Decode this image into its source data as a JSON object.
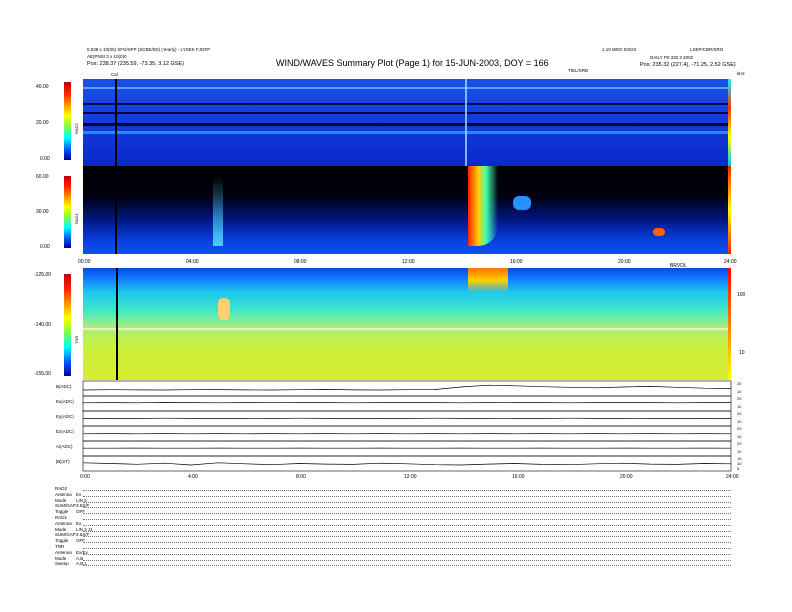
{
  "header": {
    "title": "WIND/WAVES Summary Plot (Page 1) for 15-JUN-2003, DOY = 166",
    "left_line1": "0.538 x 10(00) SFG/SFP (SCBE/D0) (Yearly) - LYSEK FJGFP",
    "left_line2": "AE(PNSI 3 x 10(0)0",
    "left_line3": "Pos:  238.37 (235.59, -73.35, 3.12 GSE)",
    "right_line1": "1.10 WED 03/O3",
    "right_line2": "LSEP/CBR/SRO",
    "right_line3": "DAILY P0 335 3 2002",
    "right_line4": "Pos:  235.32 (227.4), -71.25, 2.52 GSE)",
    "cal_label": "Cal",
    "panel1_tag": "TIEL/SRB",
    "right_khz": "kHz"
  },
  "chart_data": [
    {
      "type": "heatmap",
      "title": "",
      "ylabel": "RAD2",
      "yticks": [
        "40.00",
        "20.00",
        "0.00"
      ]
    },
    {
      "type": "heatmap",
      "title": "",
      "ylabel": "RAD1",
      "yticks": [
        "60.00",
        "30.00",
        "0.00"
      ],
      "xticks": [
        "00:00",
        "04:00",
        "08:00",
        "12:00",
        "16:00",
        "20:00",
        "24:00"
      ]
    },
    {
      "type": "heatmap",
      "title": "",
      "ylabel": "TNR",
      "yticks": [
        "-125.00",
        "-140.00",
        "-155.00"
      ],
      "right_ticks": [
        "100",
        "10"
      ],
      "right_tag": "BRVDL"
    },
    {
      "type": "line",
      "title": "",
      "x_range_hours": [
        0,
        24
      ],
      "xticks": [
        "0:00",
        "4:00",
        "8:00",
        "12:00",
        "16:00",
        "20:00",
        "24:00"
      ],
      "series": [
        {
          "name": "B(ADC)",
          "right_ticks": [
            "20",
            "10"
          ],
          "values": [
            0.4,
            0.42,
            0.41,
            0.4,
            0.42,
            0.43,
            0.41,
            0.4,
            0.42,
            0.44,
            0.41,
            0.4,
            0.42,
            0.43,
            0.6,
            0.72,
            0.68,
            0.62,
            0.58,
            0.55,
            0.6,
            0.64,
            0.58,
            0.52,
            0.5
          ]
        },
        {
          "name": "Ex(ADC)",
          "right_ticks": [
            "20",
            "10"
          ],
          "values": [
            0.55,
            0.56,
            0.55,
            0.57,
            0.56,
            0.55,
            0.56,
            0.58,
            0.57,
            0.56,
            0.55,
            0.56,
            0.57,
            0.56,
            0.55,
            0.56,
            0.57,
            0.56,
            0.55,
            0.56,
            0.57,
            0.56,
            0.55,
            0.56,
            0.56
          ]
        },
        {
          "name": "Ey(ADC)",
          "right_ticks": [
            "20",
            "10"
          ],
          "values": [
            0.5,
            0.51,
            0.5,
            0.52,
            0.51,
            0.5,
            0.51,
            0.5,
            0.52,
            0.51,
            0.5,
            0.51,
            0.5,
            0.52,
            0.51,
            0.5,
            0.51,
            0.5,
            0.52,
            0.51,
            0.5,
            0.51,
            0.5,
            0.51,
            0.5
          ]
        },
        {
          "name": "Ez(ADC)",
          "right_ticks": [
            "20",
            "10"
          ],
          "values": [
            0.48,
            0.49,
            0.48,
            0.49,
            0.48,
            0.49,
            0.48,
            0.49,
            0.48,
            0.49,
            0.48,
            0.49,
            0.48,
            0.49,
            0.48,
            0.49,
            0.48,
            0.49,
            0.48,
            0.49,
            0.48,
            0.49,
            0.48,
            0.49,
            0.48
          ]
        },
        {
          "name": "Ai(ADC)",
          "right_ticks": [
            "20",
            "10"
          ],
          "values": [
            0.52,
            0.52,
            0.53,
            0.52,
            0.52,
            0.53,
            0.52,
            0.52,
            0.53,
            0.52,
            0.52,
            0.53,
            0.52,
            0.52,
            0.53,
            0.52,
            0.52,
            0.53,
            0.52,
            0.52,
            0.53,
            0.52,
            0.52,
            0.53,
            0.52
          ]
        },
        {
          "name": "|B|(nT)",
          "right_ticks": [
            "15",
            "10",
            "5"
          ],
          "values": [
            0.55,
            0.5,
            0.45,
            0.52,
            0.4,
            0.55,
            0.48,
            0.42,
            0.5,
            0.46,
            0.44,
            0.52,
            0.48,
            0.42,
            0.4,
            0.46,
            0.5,
            0.44,
            0.42,
            0.48,
            0.52,
            0.46,
            0.44,
            0.5,
            0.48
          ]
        }
      ]
    }
  ],
  "footer": {
    "rows": [
      {
        "label": "RAD2",
        "value": ""
      },
      {
        "label": "Antenna",
        "value": "Ex"
      },
      {
        "label": "Mode",
        "value": "LIN 5"
      },
      {
        "label": "SUM/GAP",
        "value": "3.5S/F"
      },
      {
        "label": "Toggle",
        "value": "OFF"
      },
      {
        "label": "RAD1",
        "value": ""
      },
      {
        "label": "Antenna",
        "value": "Ex"
      },
      {
        "label": "Mode",
        "value": "LIN 2 J1"
      },
      {
        "label": "SUM/GAP",
        "value": "3.5S/F"
      },
      {
        "label": "Toggle",
        "value": "OFF"
      },
      {
        "label": "TNR",
        "value": ""
      },
      {
        "label": "Antenna",
        "value": "Ex/Ey"
      },
      {
        "label": "Mode",
        "value": "A,B"
      },
      {
        "label": "Sweep",
        "value": "A,B,L"
      }
    ]
  },
  "colors": {
    "background_low": "#0a2ad8",
    "burst_high": "#ff2000",
    "tnr_high": "#c8e83a"
  }
}
